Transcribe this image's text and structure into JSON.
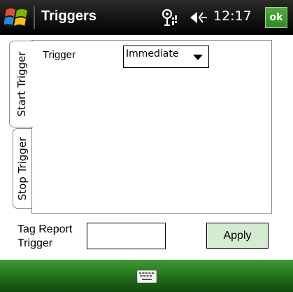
{
  "titlebar": {
    "title": "Triggers",
    "clock": "12:17",
    "ok_label": "ok",
    "icons": [
      "windows-start-icon",
      "antenna-icon",
      "volume-icon"
    ]
  },
  "tabs": [
    {
      "label": "Start Trigger",
      "selected": true
    },
    {
      "label": "Stop Trigger",
      "selected": false
    }
  ],
  "start_trigger": {
    "trigger_label": "Trigger",
    "trigger_value": "Immediate"
  },
  "form": {
    "tag_report_label_line1": "Tag Report",
    "tag_report_label_line2": "Trigger",
    "tag_report_value": "",
    "apply_label": "Apply"
  },
  "softbar": {
    "icon": "keyboard-icon"
  },
  "colors": {
    "title_bar": "#111111",
    "ok_button": "#3c9e2e",
    "apply_button": "#d6ecd2",
    "soft_bar": "#2a7a22"
  }
}
